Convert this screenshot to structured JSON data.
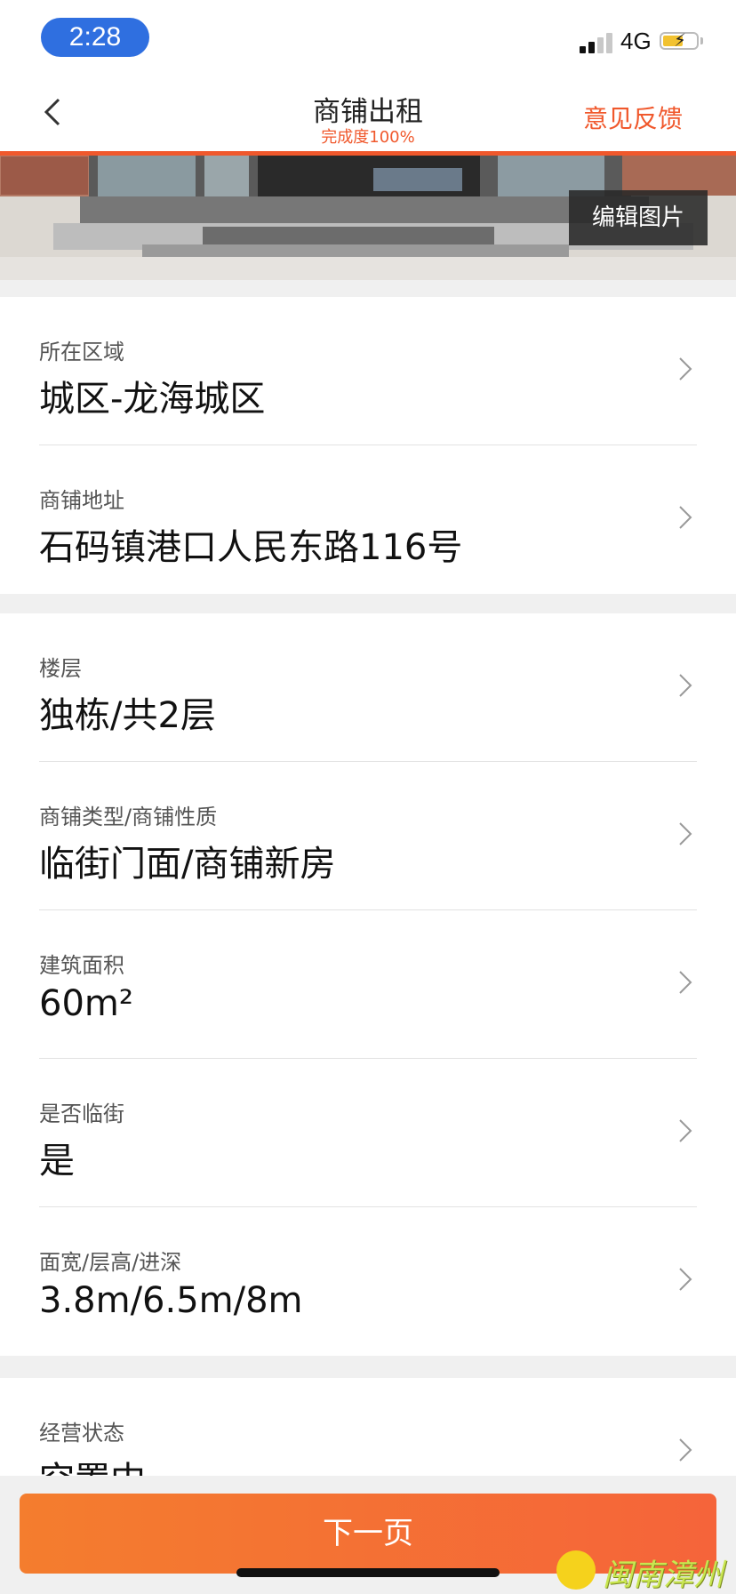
{
  "status_bar": {
    "time": "2:28",
    "network": "4G"
  },
  "nav": {
    "title": "商铺出租",
    "completion": "完成度100%",
    "feedback_label": "意见反馈"
  },
  "photo": {
    "edit_label": "编辑图片"
  },
  "section1": [
    {
      "label": "所在区域",
      "value": "城区-龙海城区"
    },
    {
      "label": "商铺地址",
      "value": "石码镇港口人民东路116号"
    }
  ],
  "section2": [
    {
      "label": "楼层",
      "value": "独栋/共2层"
    },
    {
      "label": "商铺类型/商铺性质",
      "value": "临街门面/商铺新房"
    },
    {
      "label": "建筑面积",
      "value": "60m²"
    },
    {
      "label": "是否临街",
      "value": "是"
    },
    {
      "label": "面宽/层高/进深",
      "value": "3.8m/6.5m/8m"
    }
  ],
  "section3": [
    {
      "label": "经营状态",
      "value": "空置中"
    }
  ],
  "footer": {
    "next_label": "下一页"
  },
  "watermark": {
    "text": "闽南漳州"
  },
  "colors": {
    "accent": "#f0582c",
    "button_start": "#f47d2e",
    "button_end": "#f5643a",
    "time_pill": "#2f6fe0"
  }
}
